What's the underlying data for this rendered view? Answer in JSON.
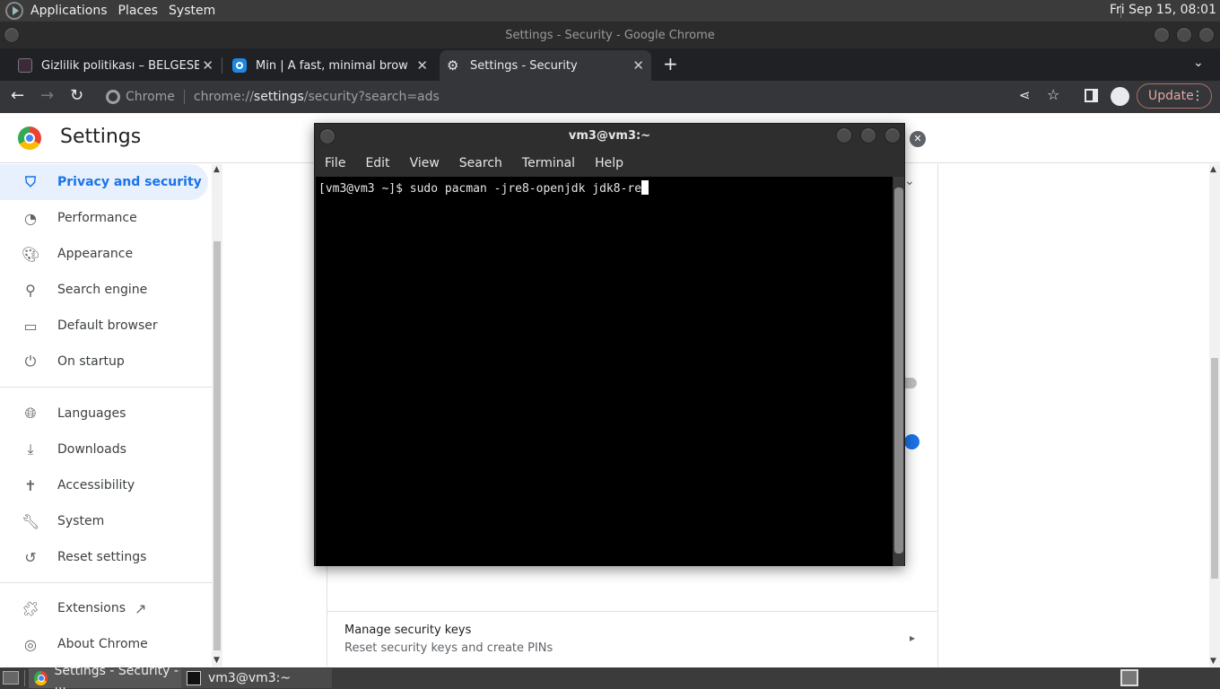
{
  "panel": {
    "menus": [
      "Applications",
      "Places",
      "System"
    ],
    "clock": "Fri Sep 15, 08:01"
  },
  "chrome": {
    "window_title": "Settings - Security - Google Chrome",
    "tabs": [
      {
        "title": "Gizlilik politikası – BELGESELS",
        "favicon": "belgesel-favicon"
      },
      {
        "title": "Min | A fast, minimal browser t",
        "favicon": "min-favicon"
      },
      {
        "title": "Settings - Security",
        "favicon": "gear-icon"
      }
    ],
    "omnibox": {
      "site_label": "Chrome",
      "url_prefix": "chrome://",
      "url_host": "settings",
      "url_path": "/security?search=ads"
    },
    "update_label": "Update"
  },
  "settings": {
    "title": "Settings",
    "nav": [
      {
        "label": "Privacy and security",
        "icon": "shield-icon",
        "active": true
      },
      {
        "label": "Performance",
        "icon": "speedometer-icon"
      },
      {
        "label": "Appearance",
        "icon": "palette-icon"
      },
      {
        "label": "Search engine",
        "icon": "search-icon"
      },
      {
        "label": "Default browser",
        "icon": "browser-icon"
      },
      {
        "label": "On startup",
        "icon": "power-icon"
      },
      {
        "label": "Languages",
        "icon": "globe-icon"
      },
      {
        "label": "Downloads",
        "icon": "download-icon"
      },
      {
        "label": "Accessibility",
        "icon": "accessibility-icon"
      },
      {
        "label": "System",
        "icon": "wrench-icon"
      },
      {
        "label": "Reset settings",
        "icon": "history-icon"
      },
      {
        "label": "Extensions",
        "icon": "puzzle-icon"
      },
      {
        "label": "About Chrome",
        "icon": "chrome-icon"
      }
    ],
    "manage_keys": {
      "title": "Manage security keys",
      "subtitle": "Reset security keys and create PINs"
    }
  },
  "terminal": {
    "title": "vm3@vm3:~",
    "menu": [
      "File",
      "Edit",
      "View",
      "Search",
      "Terminal",
      "Help"
    ],
    "line": "[vm3@vm3 ~]$ sudo pacman -jre8-openjdk jdk8-re"
  },
  "taskbar": {
    "tasks": [
      {
        "label": "Settings - Security - ...",
        "icon": "chrome-icon"
      },
      {
        "label": "vm3@vm3:~",
        "icon": "terminal-icon"
      }
    ]
  },
  "colors": {
    "accent": "#1a73e8",
    "active_nav_bg": "#e8f0fe",
    "panel_bg": "#3b3b3b",
    "chrome_dark": "#202124"
  }
}
